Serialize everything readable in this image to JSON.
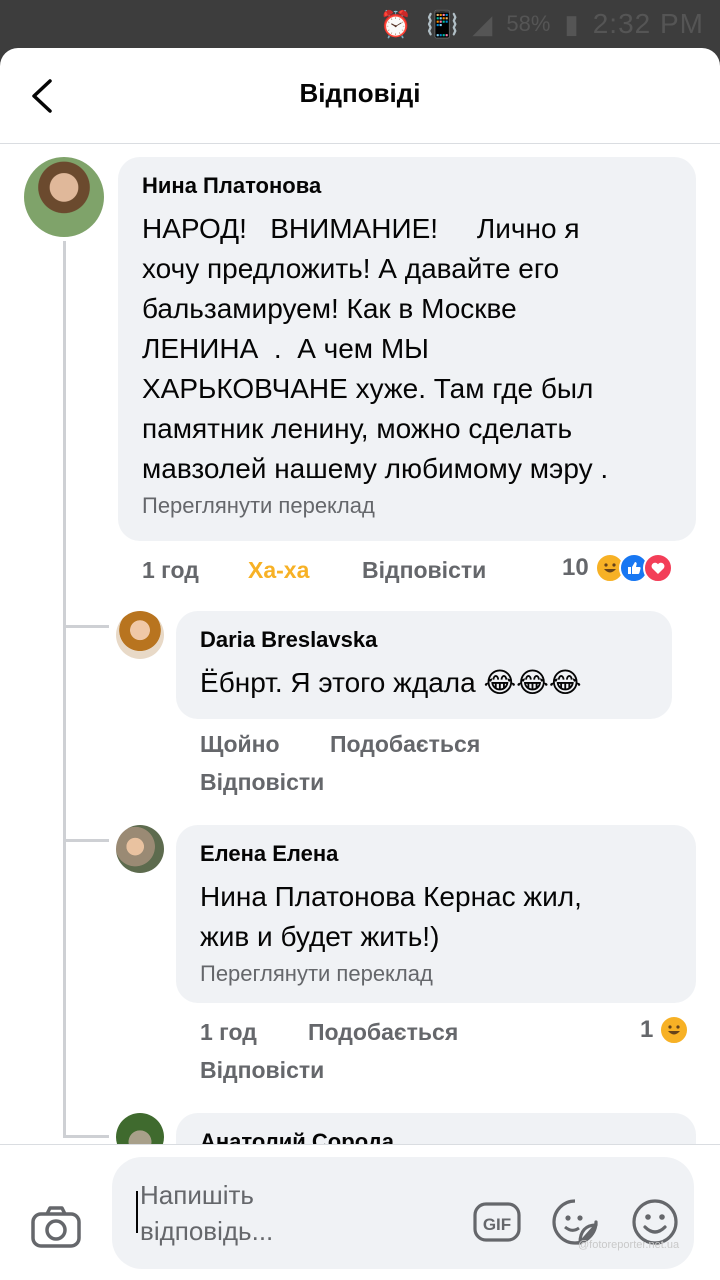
{
  "status_bar": {
    "battery": "58%",
    "time": "2:32 PM"
  },
  "header": {
    "title": "Відповіді"
  },
  "main_comment": {
    "author": "Нина Платонова",
    "text": "НАРОД!   ВНИМАНИЕ!     Лично я\nхочу предложить! А давайте его\nбальзамируем! Как в Москве\nЛЕНИНА  .  А чем МЫ\nХАРЬКОВЧАНЕ хуже. Там где был\nпамятник ленину, можно сделать\nмавзолей нашему любимому мэру .",
    "translate": "Переглянути переклад",
    "time": "1 год",
    "reaction_label": "Ха-ха",
    "reply": "Відповісти",
    "reaction_count": "10"
  },
  "replies": [
    {
      "author": "Daria Breslavska",
      "text": "Ёбнрт. Я этого ждала 😂😂😂",
      "time": "Щойно",
      "like": "Подобається",
      "reply": "Відповісти"
    },
    {
      "author": "Елена Елена",
      "text": "Нина Платонова Кернас жил,\nжив и будет жить!)",
      "translate": "Переглянути переклад",
      "time": "1 год",
      "like": "Подобається",
      "reply": "Відповісти",
      "reaction_count": "1"
    },
    {
      "author": "Анатолий Сорода"
    }
  ],
  "composer": {
    "placeholder": "Напишіть\nвідповідь...",
    "gif_label": "GIF",
    "watermark": "@fotoreporter.net.ua"
  },
  "colors": {
    "haha": "#f7b125",
    "like": "#1877f2",
    "love": "#f33e58",
    "bubble": "#f0f2f5"
  }
}
